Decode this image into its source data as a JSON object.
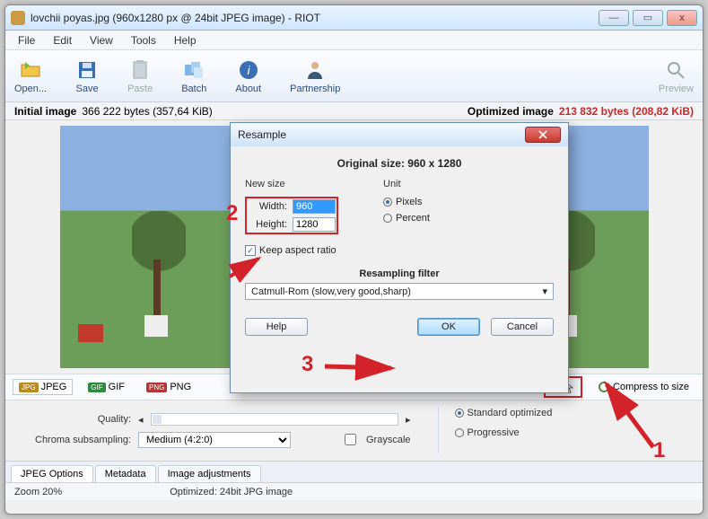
{
  "titlebar": {
    "title": "lovchii poyas.jpg  (960x1280 px @ 24bit JPEG image) - RIOT"
  },
  "menu": {
    "file": "File",
    "edit": "Edit",
    "view": "View",
    "tools": "Tools",
    "help": "Help"
  },
  "toolbar": {
    "open": "Open...",
    "save": "Save",
    "paste": "Paste",
    "batch": "Batch",
    "about": "About",
    "partnership": "Partnership",
    "preview": "Preview"
  },
  "info": {
    "initial_label": "Initial image",
    "initial_val": "366 222 bytes (357,64 KiB)",
    "opt_label": "Optimized image",
    "opt_val": "213 832 bytes (208,82 KiB)"
  },
  "fmt": {
    "jpeg": "JPEG",
    "gif": "GIF",
    "png": "PNG",
    "compress": "Compress to size"
  },
  "controls": {
    "quality": "Quality:",
    "chroma": "Chroma subsampling:",
    "chroma_val": "Medium (4:2:0)",
    "grayscale": "Grayscale",
    "std": "Standard optimized",
    "prog": "Progressive"
  },
  "tabs": {
    "jpeg": "JPEG Options",
    "meta": "Metadata",
    "adj": "Image adjustments"
  },
  "status": {
    "zoom": "Zoom 20%",
    "mode": "Optimized: 24bit JPG image"
  },
  "dialog": {
    "title": "Resample",
    "orig": "Original size: 960 x 1280",
    "new_size": "New size",
    "unit": "Unit",
    "width": "Width:",
    "height": "Height:",
    "w_val": "960",
    "h_val": "1280",
    "pixels": "Pixels",
    "percent": "Percent",
    "keep": "Keep aspect ratio",
    "filter_label": "Resampling filter",
    "filter_val": "Catmull-Rom (slow,very good,sharp)",
    "help": "Help",
    "ok": "OK",
    "cancel": "Cancel"
  },
  "ann": {
    "n1": "1",
    "n2": "2",
    "n3": "3"
  }
}
